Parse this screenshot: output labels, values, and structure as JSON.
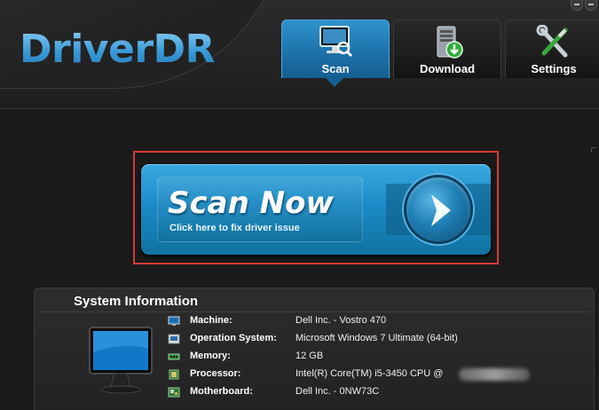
{
  "app": {
    "logo": "DriverDR"
  },
  "tabs": [
    {
      "label": "Scan",
      "icon": "monitor-scan-icon",
      "active": true
    },
    {
      "label": "Download",
      "icon": "server-download-icon",
      "active": false
    },
    {
      "label": "Settings",
      "icon": "tools-icon",
      "active": false
    }
  ],
  "scan": {
    "title": "Scan Now",
    "subtitle": "Click here to fix driver issue",
    "highlight_color": "#d63a3a",
    "accent_color": "#1b8bc7"
  },
  "system_info": {
    "title": "System Information",
    "rows": [
      {
        "label": "Machine:",
        "value": "Dell Inc. - Vostro 470",
        "icon": "machine-icon"
      },
      {
        "label": "Operation System:",
        "value": "Microsoft Windows 7 Ultimate  (64-bit)",
        "icon": "os-icon"
      },
      {
        "label": "Memory:",
        "value": "12 GB",
        "icon": "memory-icon"
      },
      {
        "label": "Processor:",
        "value": "Intel(R) Core(TM) i5-3450 CPU @",
        "icon": "processor-icon"
      },
      {
        "label": "Motherboard:",
        "value": "Dell Inc. - 0NW73C",
        "icon": "motherboard-icon"
      }
    ]
  }
}
